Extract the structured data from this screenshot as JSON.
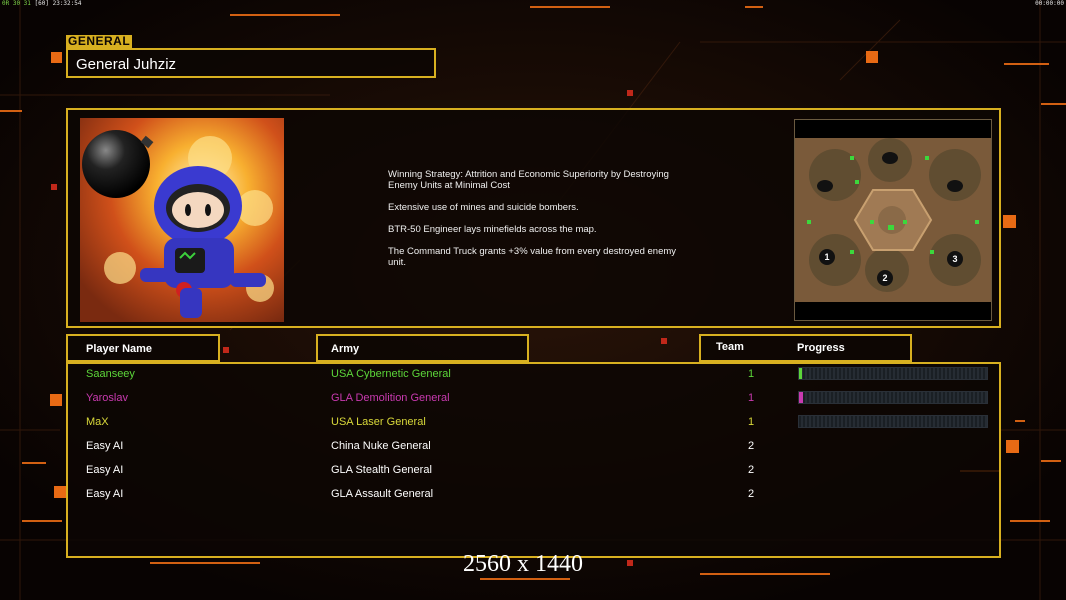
{
  "topbar": {
    "fps": "0R 30 31",
    "stats": "[60] 23:32:54",
    "clock": "00:00:00"
  },
  "general": {
    "section_label": "GENERAL",
    "name": "General Juhziz",
    "description": [
      "Winning Strategy: Attrition and Economic Superiority by Destroying\n Enemy Units at Minimal Cost",
      "Extensive use of mines and suicide bombers.",
      "BTR-50 Engineer lays minefields across the map.",
      "The Command Truck grants +3% value from every destroyed enemy\n unit."
    ]
  },
  "minimap": {
    "start_positions": [
      "1",
      "2",
      "3"
    ]
  },
  "table": {
    "headers": {
      "player": "Player Name",
      "army": "Army",
      "team": "Team",
      "progress": "Progress"
    },
    "rows": [
      {
        "player": "Saanseey",
        "army": "USA Cybernetic General",
        "team": "1",
        "color": "#5cd63a",
        "progress": 0.01,
        "show_bar": true
      },
      {
        "player": "Yaroslav",
        "army": "GLA Demolition General",
        "team": "1",
        "color": "#c93ab0",
        "progress": 0.02,
        "show_bar": true
      },
      {
        "player": "MaX",
        "army": "USA Laser General",
        "team": "1",
        "color": "#d8d83a",
        "progress": 0,
        "show_bar": true
      },
      {
        "player": "Easy AI",
        "army": "China Nuke General",
        "team": "2",
        "color": "#ffffff",
        "progress": 0,
        "show_bar": false
      },
      {
        "player": "Easy AI",
        "army": "GLA Stealth General",
        "team": "2",
        "color": "#ffffff",
        "progress": 0,
        "show_bar": false
      },
      {
        "player": "Easy AI",
        "army": "GLA Assault General",
        "team": "2",
        "color": "#ffffff",
        "progress": 0,
        "show_bar": false
      }
    ]
  },
  "overlay": {
    "resolution": "2560 x 1440"
  },
  "colors": {
    "accent": "#d8b020",
    "background": "#0c0604",
    "grid_orange": "#e86a14"
  }
}
